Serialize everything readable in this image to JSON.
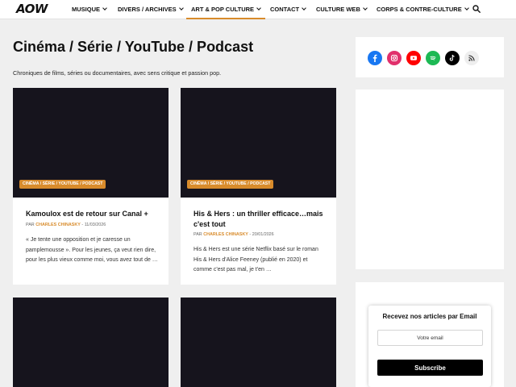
{
  "site": {
    "logo": "AOW"
  },
  "nav": {
    "items": [
      {
        "label": "MUSIQUE"
      },
      {
        "label": "DIVERS / ARCHIVES"
      },
      {
        "label": "ART & POP CULTURE"
      },
      {
        "label": "CONTACT"
      },
      {
        "label": "CULTURE WEB"
      },
      {
        "label": "CORPS & CONTRE-CULTURE"
      }
    ],
    "active": "ART & POP CULTURE",
    "accent_color": "#d88b2b"
  },
  "header": {
    "title": "Cinéma / Série / YouTube / Podcast",
    "description": "Chroniques de films, séries ou documentaires, avec sens critique et passion pop."
  },
  "posts": [
    {
      "category": "CINÉMA / SÉRIE / YOUTUBE / PODCAST",
      "title": "Kamoulox est de retour sur Canal +",
      "by": "PAR",
      "author": "CHARLES CHINASKY",
      "sep": " - ",
      "date": "11/03/2026",
      "excerpt": "« Je tente une opposition et je caresse un pamplemousse ». Pour les jeunes, ça veut rien dire, pour les plus vieux comme moi, vous avez tout de …"
    },
    {
      "category": "CINÉMA / SÉRIE / YOUTUBE / PODCAST",
      "title": "His & Hers : un thriller efficace…mais c'est tout",
      "by": "PAR",
      "author": "CHARLES CHINASKY",
      "sep": " - ",
      "date": "20/01/2026",
      "excerpt": "His & Hers est une série Netflix basé sur le roman His & Hers d'Alice Feeney (publié en 2020) et comme c'est pas mal, je t'en …"
    }
  ],
  "social": [
    {
      "icon": "facebook-icon",
      "color": "#1877f2"
    },
    {
      "icon": "instagram-icon",
      "color": "#e1306c"
    },
    {
      "icon": "youtube-icon",
      "color": "#ff0000"
    },
    {
      "icon": "spotify-icon",
      "color": "#1db954"
    },
    {
      "icon": "tiktok-icon",
      "color": "#000000"
    },
    {
      "icon": "rss-icon",
      "color": "#eeeeee"
    }
  ],
  "newsletter": {
    "title": "Recevez nos articles par Email",
    "placeholder": "Votre email",
    "button": "Subscribe"
  }
}
